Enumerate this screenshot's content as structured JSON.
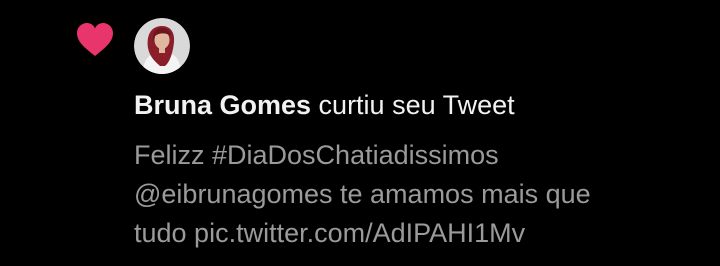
{
  "notification": {
    "icon": "heart-icon",
    "accent_color": "#e8356b",
    "user_name": "Bruna Gomes",
    "action_text": " curtiu seu Tweet",
    "tweet_lines": [
      "Felizz #DiaDosChatiadissimos",
      "@eibrunagomes te amamos mais que",
      "tudo pic.twitter.com/AdIPAHI1Mv"
    ]
  }
}
